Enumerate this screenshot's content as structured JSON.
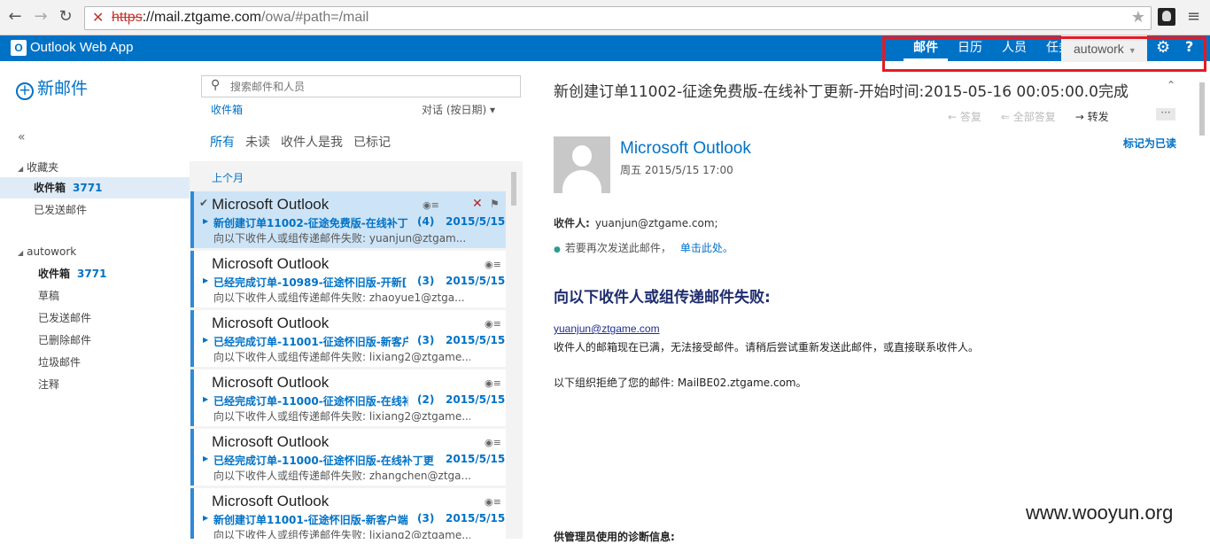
{
  "browser": {
    "url_protocol": "https",
    "url_host": "://mail.ztgame.com",
    "url_path": "/owa/#path=/mail"
  },
  "header": {
    "app_title": "Outlook Web App",
    "nav": [
      {
        "label": "邮件"
      },
      {
        "label": "日历"
      },
      {
        "label": "人员"
      },
      {
        "label": "任务"
      }
    ],
    "user": "autowork"
  },
  "leftnav": {
    "new_mail": "新邮件",
    "collapse": "«",
    "favorites": "收藏夹",
    "fav_items": [
      {
        "label": "收件箱",
        "count": "3771"
      },
      {
        "label": "已发送邮件"
      }
    ],
    "account": "autowork",
    "account_items": [
      {
        "label": "收件箱",
        "count": "3771"
      },
      {
        "label": "草稿"
      },
      {
        "label": "已发送邮件"
      },
      {
        "label": "已删除邮件"
      },
      {
        "label": "垃圾邮件"
      },
      {
        "label": "注释"
      }
    ]
  },
  "list": {
    "search_placeholder": "搜索邮件和人员",
    "folder": "收件箱",
    "sort": "对话 (按日期) ▾",
    "filters": [
      "所有",
      "未读",
      "收件人是我",
      "已标记"
    ],
    "group": "上个月",
    "messages": [
      {
        "sender": "Microsoft Outlook",
        "subject": "新创建订单11002-征途免费版-在线补丁",
        "count": "(4)",
        "date": "2015/5/15",
        "preview": "向以下收件人或组传递邮件失败: yuanjun@ztgam..."
      },
      {
        "sender": "Microsoft Outlook",
        "subject": "已经完成订单-10989-征途怀旧版-开新[",
        "count": "(3)",
        "date": "2015/5/15",
        "preview": "向以下收件人或组传递邮件失败: zhaoyue1@ztga..."
      },
      {
        "sender": "Microsoft Outlook",
        "subject": "已经完成订单-11001-征途怀旧版-新客户",
        "count": "(3)",
        "date": "2015/5/15",
        "preview": "向以下收件人或组传递邮件失败: lixiang2@ztgame..."
      },
      {
        "sender": "Microsoft Outlook",
        "subject": "已经完成订单-11000-征途怀旧版-在线补",
        "count": "(2)",
        "date": "2015/5/15",
        "preview": "向以下收件人或组传递邮件失败: lixiang2@ztgame..."
      },
      {
        "sender": "Microsoft Outlook",
        "subject": "已经完成订单-11000-征途怀旧版-在线补丁更!",
        "count": "",
        "date": "2015/5/15",
        "preview": "向以下收件人或组传递邮件失败: zhangchen@ztga..."
      },
      {
        "sender": "Microsoft Outlook",
        "subject": "新创建订单11001-征途怀旧版-新客户端",
        "count": "(3)",
        "date": "2015/5/15",
        "preview": "向以下收件人或组传递邮件失败: lixiang2@ztgame..."
      }
    ]
  },
  "reading": {
    "subject": "新创建订单11002-征途免费版-在线补丁更新-开始时间:2015-05-16 00:05:00.0完成",
    "reply": "答复",
    "reply_all": "全部答复",
    "forward": "转发",
    "more": "···",
    "from": "Microsoft Outlook",
    "date": "周五 2015/5/15 17:00",
    "mark_read": "标记为已读",
    "to_label": "收件人:",
    "to_value": "yuanjun@ztgame.com;",
    "note": "若要再次发送此邮件，",
    "note_link": "单击此处。",
    "heading": "向以下收件人或组传递邮件失败:",
    "address": "yuanjun@ztgame.com",
    "body1": "收件人的邮箱现在已满，无法接受邮件。请稍后尝试重新发送此邮件，或直接联系收件人。",
    "body2": "以下组织拒绝了您的邮件: MailBE02.ztgame.com。",
    "body3": "供管理员使用的诊断信息:"
  },
  "watermark": "www.wooyun.org"
}
